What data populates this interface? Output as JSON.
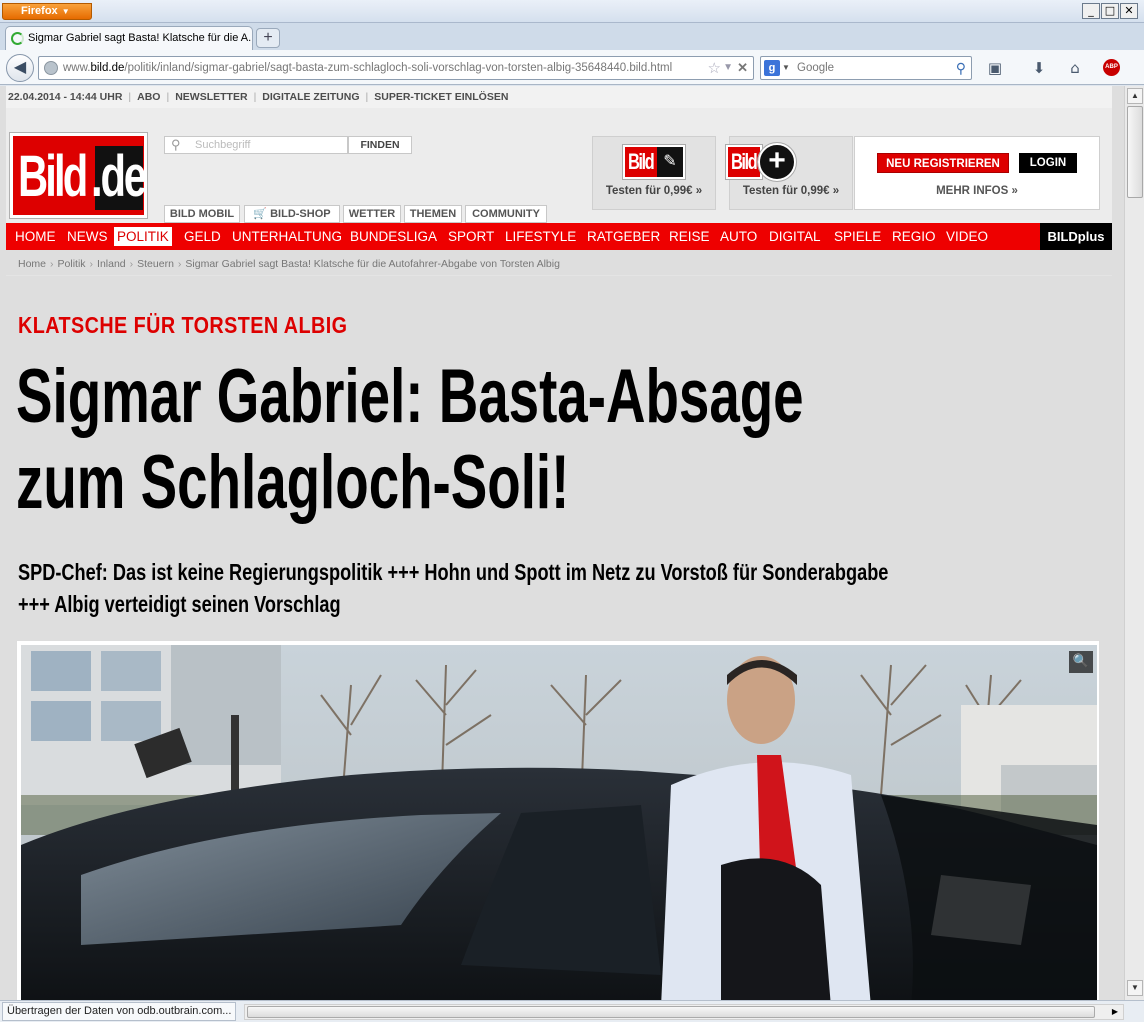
{
  "browser": {
    "app_button": "Firefox",
    "tab_title": "Sigmar Gabriel sagt Basta! Klatsche für die A...",
    "url_prefix": "www.",
    "url_domain": "bild.de",
    "url_path": "/politik/inland/sigmar-gabriel/sagt-basta-zum-schlagloch-soli-vorschlag-von-torsten-albig-35648440.bild.html",
    "search_engine": "Google",
    "search_placeholder": "Google",
    "status": "Übertragen der Daten von odb.outbrain.com..."
  },
  "site": {
    "topline": {
      "datetime": "22.04.2014 - 14:44 UHR",
      "links": [
        "ABO",
        "NEWSLETTER",
        "DIGITALE ZEITUNG",
        "SUPER-TICKET EINLÖSEN"
      ]
    },
    "logo_text": "Bild",
    "logo_suffix": ".de",
    "search": {
      "placeholder": "Suchbegriff",
      "button": "FINDEN"
    },
    "sublinks": [
      "BILD MOBIL",
      "BILD-SHOP",
      "WETTER",
      "THEMEN",
      "COMMUNITY"
    ],
    "promos": [
      {
        "logo": "Bild",
        "text": "Testen für 0,99€ »"
      },
      {
        "logo": "Bild",
        "text": "Testen für 0,99€ »"
      }
    ],
    "account": {
      "register": "NEU REGISTRIEREN",
      "login": "LOGIN",
      "more": "MEHR INFOS »"
    },
    "nav": [
      "HOME",
      "NEWS",
      "POLITIK",
      "GELD",
      "UNTERHALTUNG",
      "BUNDESLIGA",
      "SPORT",
      "LIFESTYLE",
      "RATGEBER",
      "REISE",
      "AUTO",
      "DIGITAL",
      "SPIELE",
      "REGIO",
      "VIDEO"
    ],
    "nav_active": "POLITIK",
    "nav_plus": "BILDplus",
    "breadcrumb": [
      "Home",
      "Politik",
      "Inland",
      "Steuern",
      "Sigmar Gabriel sagt Basta! Klatsche für die Autofahrer-Abgabe von Torsten Albig"
    ]
  },
  "article": {
    "kicker": "KLATSCHE FÜR TORSTEN ALBIG",
    "headline_line1": "Sigmar Gabriel: Basta-Absage",
    "headline_line2": "zum Schlagloch-Soli!",
    "subline_line1": "SPD-Chef: Das ist keine Regierungspolitik +++ Hohn und Spott im Netz zu Vorstoß für Sonderabgabe",
    "subline_line2": "+++ Albig verteidigt seinen Vorschlag"
  },
  "colors": {
    "brand_red": "#dd0000",
    "black": "#000000",
    "firefox_orange": "#e66b00"
  }
}
